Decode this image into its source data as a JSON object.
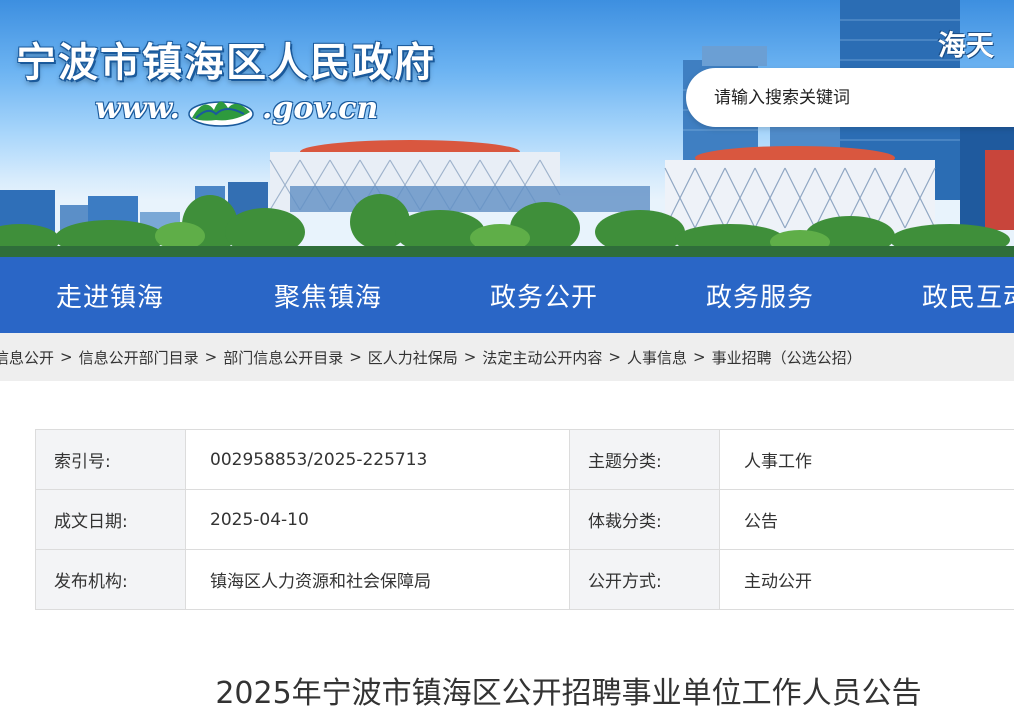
{
  "banner": {
    "site_title": "宁波市镇海区人民政府",
    "site_url_prefix": "www.",
    "site_url_suffix": ".gov.cn",
    "slogan": "海天",
    "search_placeholder": "请输入搜索关键词"
  },
  "nav": {
    "items": [
      "走进镇海",
      "聚焦镇海",
      "政务公开",
      "政务服务",
      "政民互动"
    ]
  },
  "breadcrumb": {
    "items": [
      "信息公开",
      "信息公开部门目录",
      "部门信息公开目录",
      "区人力社保局",
      "法定主动公开内容",
      "人事信息",
      "事业招聘（公选公招）"
    ],
    "separator": ">"
  },
  "meta": {
    "index_label": "索引号:",
    "index_value": "002958853/2025-225713",
    "topic_label": "主题分类:",
    "topic_value": "人事工作",
    "date_label": "成文日期:",
    "date_value": "2025-04-10",
    "genre_label": "体裁分类:",
    "genre_value": "公告",
    "publisher_label": "发布机构:",
    "publisher_value": "镇海区人力资源和社会保障局",
    "disclosure_label": "公开方式:",
    "disclosure_value": "主动公开"
  },
  "article": {
    "title": "2025年宁波市镇海区公开招聘事业单位工作人员公告"
  },
  "colors": {
    "nav_bg": "#2a66c6",
    "breadcrumb_bg": "#eeeeee",
    "label_cell_bg": "#f3f4f6"
  }
}
